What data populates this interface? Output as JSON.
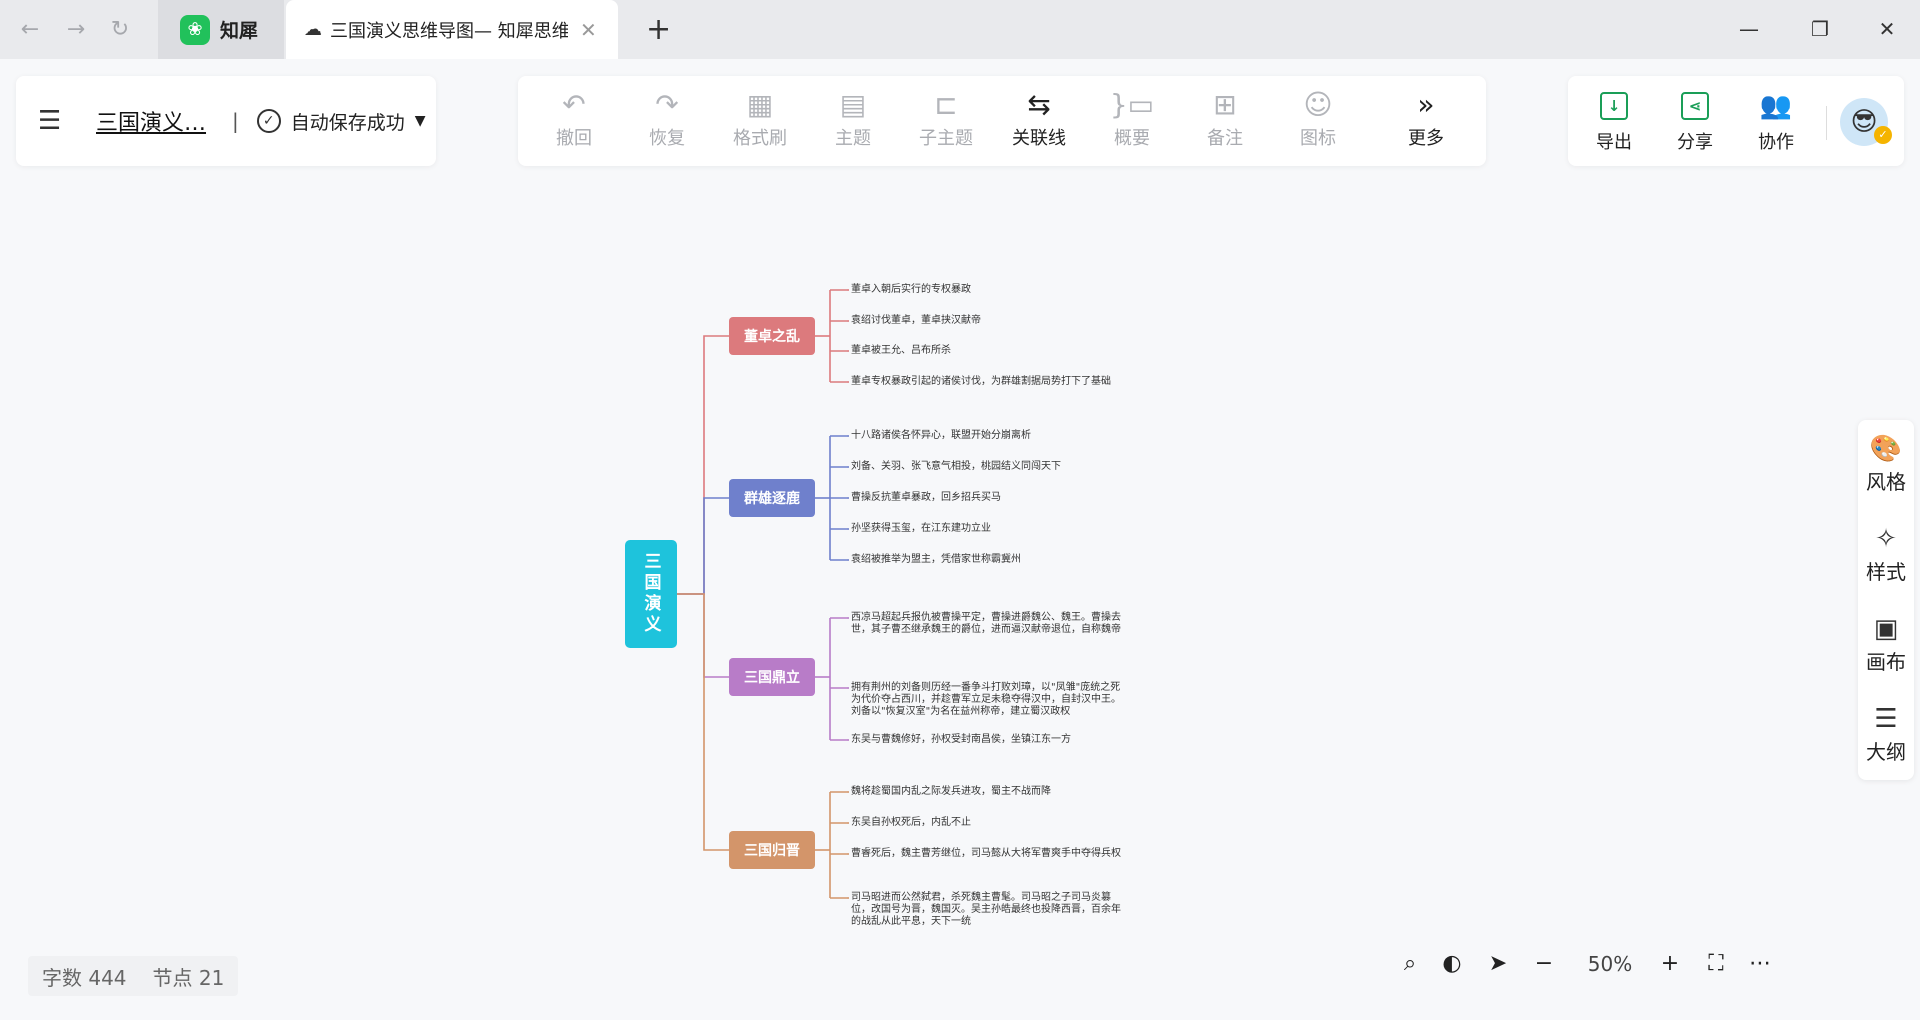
{
  "tabs": {
    "app_name": "知犀",
    "doc_title": "三国演义思维导图— 知犀思维导图",
    "new_tab": "+",
    "close": "✕"
  },
  "file": {
    "title": "三国演义…",
    "separator": "|",
    "save_status": "自动保存成功"
  },
  "toolbar": {
    "undo": "撤回",
    "redo": "恢复",
    "format_brush": "格式刷",
    "topic": "主题",
    "subtopic": "子主题",
    "relation_line": "关联线",
    "summary": "概要",
    "note": "备注",
    "icon": "图标",
    "more": "更多"
  },
  "actions": {
    "export": "导出",
    "share": "分享",
    "collaborate": "协作"
  },
  "side": {
    "style_theme": "风格",
    "style": "样式",
    "layout": "画布",
    "outline": "大纲"
  },
  "mindmap": {
    "root": "三国演义",
    "branches": [
      {
        "label": "董卓之乱",
        "color": "#dc7a7d",
        "leaves": [
          "董卓入朝后实行的专权暴政",
          "袁绍讨伐董卓，董卓挟汉献帝",
          "董卓被王允、吕布所杀",
          "董卓专权暴政引起的诸侯讨伐，为群雄割据局势打下了基础"
        ]
      },
      {
        "label": "群雄逐鹿",
        "color": "#6f80cc",
        "leaves": [
          "十八路诸侯各怀异心，联盟开始分崩离析",
          "刘备、关羽、张飞意气相投，桃园结义同闯天下",
          "曹操反抗董卓暴政，回乡招兵买马",
          "孙坚获得玉玺，在江东建功立业",
          "袁绍被推举为盟主，凭借家世称霸冀州"
        ]
      },
      {
        "label": "三国鼎立",
        "color": "#b87cc8",
        "leaves": [
          "西凉马超起兵报仇被曹操平定，曹操进爵魏公、魏王。曹操去世，其子曹丕继承魏王的爵位，进而逼汉献帝退位，自称魏帝",
          "拥有荆州的刘备则历经一番争斗打败刘璋，以\"凤雏\"庞统之死为代价夺占西川，并趁曹军立足未稳夺得汉中，自封汉中王。刘备以\"恢复汉室\"为名在益州称帝，建立蜀汉政权",
          "东吴与曹魏修好，孙权受封南昌侯，坐镇江东一方"
        ]
      },
      {
        "label": "三国归晋",
        "color": "#d3956a",
        "leaves": [
          "魏将趁蜀国内乱之际发兵进攻，蜀主不战而降",
          "东吴自孙权死后，内乱不止",
          "曹睿死后，魏主曹芳继位，司马懿从大将军曹爽手中夺得兵权",
          "司马昭进而公然弑君，杀死魏主曹髦。司马昭之子司马炎篡位，改国号为晋，魏国灭。吴主孙皓最终也投降西晋，百余年的战乱从此平息，天下一统"
        ]
      }
    ]
  },
  "status": {
    "word_count": "字数 444",
    "node_count": "节点 21"
  },
  "zoom": {
    "value": "50%",
    "minus": "−",
    "plus": "+"
  },
  "colors": {
    "accent_green": "#1a9e57",
    "root": "#1ec3dc"
  }
}
